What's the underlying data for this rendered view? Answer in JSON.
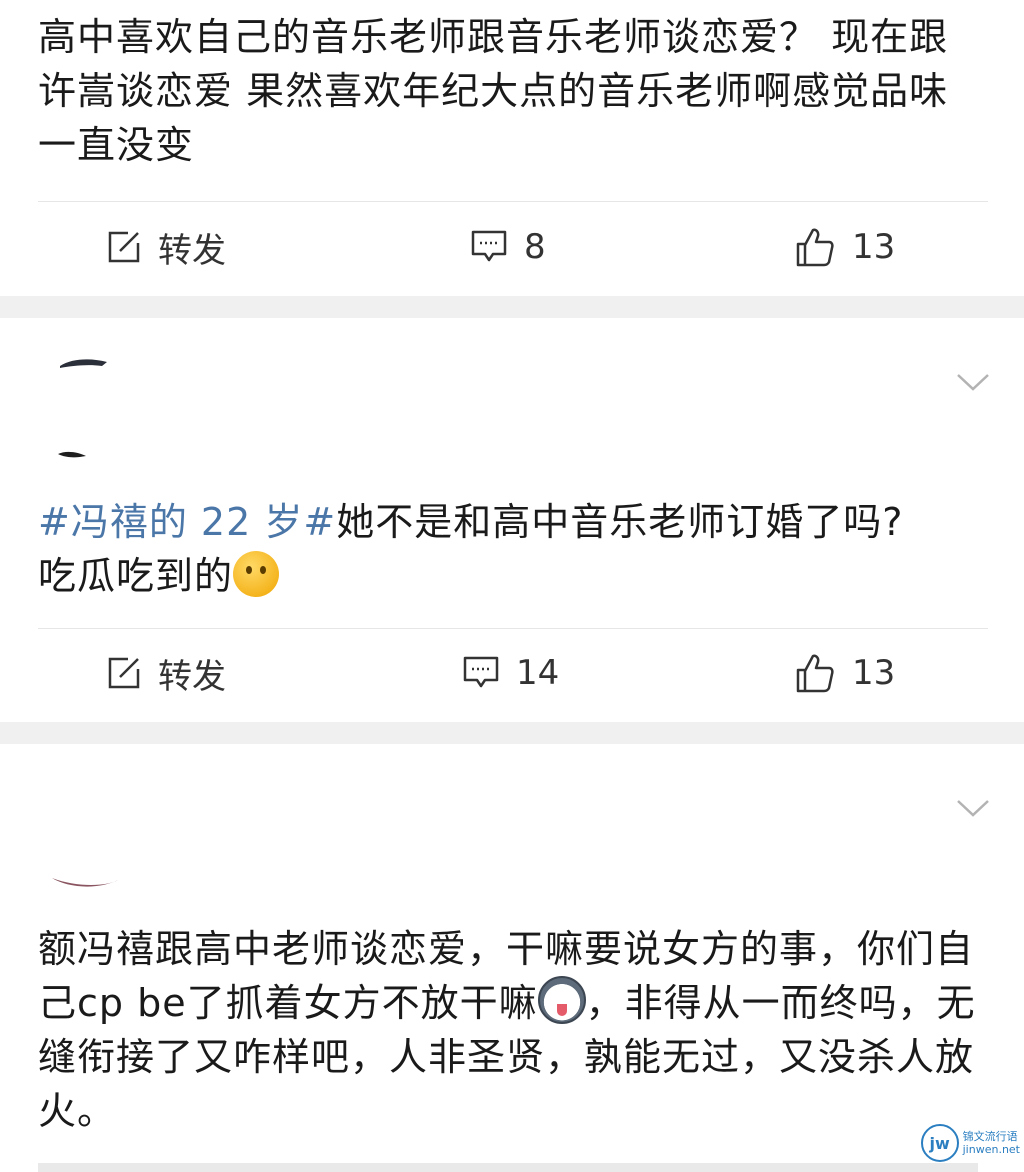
{
  "posts": [
    {
      "text": "高中喜欢自己的音乐老师跟音乐老师谈恋爱？ 现在跟许嵩谈恋爱 果然喜欢年纪大点的音乐老师啊感觉品味一直没变",
      "actions": {
        "repost_label": "转发",
        "comment_count": "8",
        "like_count": "13"
      }
    },
    {
      "hashtag": "#冯禧的 22 岁#",
      "text_line1": "她不是和高中音乐老师订婚了吗?",
      "text_line2": "吃瓜吃到的",
      "emoji": "thinking-face-emoji",
      "actions": {
        "repost_label": "转发",
        "comment_count": "14",
        "like_count": "13"
      }
    },
    {
      "text_part1": "额冯禧跟高中老师谈恋爱，干嘛要说女方的事，你们自己cp be了抓着女方不放干嘛",
      "text_part2": "，非得从一而终吗，无缝衔接了又咋样吧，人非圣贤，孰能无过，又没杀人放火。",
      "emoji": "husky-dog-emoji"
    }
  ],
  "watermark": {
    "logo": "jw",
    "name": "锦文流行语",
    "domain": "jinwen.net"
  },
  "colors": {
    "hashtag": "#4a76a8",
    "separator": "#f0f0f0",
    "watermark": "#2b7fc1"
  }
}
